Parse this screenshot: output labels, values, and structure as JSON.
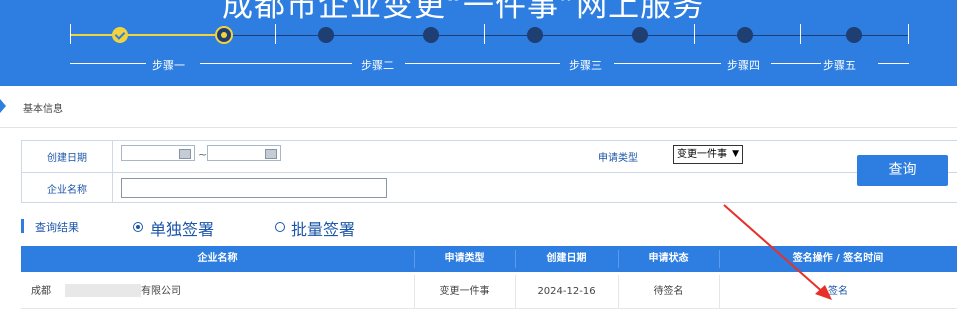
{
  "banner": {
    "title": "成都市企业变更“一件事”网上服务",
    "steps": [
      "步骤一",
      "步骤二",
      "步骤三",
      "步骤四",
      "步骤五"
    ]
  },
  "section": {
    "title": "基本信息"
  },
  "form": {
    "created_date_label": "创建日期",
    "date_separator": "~",
    "date_from_value": "",
    "date_to_value": "",
    "apply_type_label": "申请类型",
    "apply_type_selected": "变更一件事",
    "company_name_label": "企业名称",
    "company_name_value": "",
    "query_button": "查询"
  },
  "results": {
    "title": "查询结果",
    "radio_single": "单独签署",
    "radio_batch": "批量签署",
    "selected_mode": "单独签署",
    "columns": [
      "企业名称",
      "申请类型",
      "创建日期",
      "申请状态",
      "签名操作 / 签名时间"
    ],
    "rows": [
      {
        "company_prefix": "成都",
        "company_suffix": "有限公司",
        "apply_type": "变更一件事",
        "created_date": "2024-12-16",
        "status": "待签名",
        "action": "签名"
      }
    ]
  },
  "colors": {
    "primary": "#2d7ee0",
    "step_done": "#f2d33e",
    "link": "#1b56a8",
    "annotation": "#e8302a"
  }
}
